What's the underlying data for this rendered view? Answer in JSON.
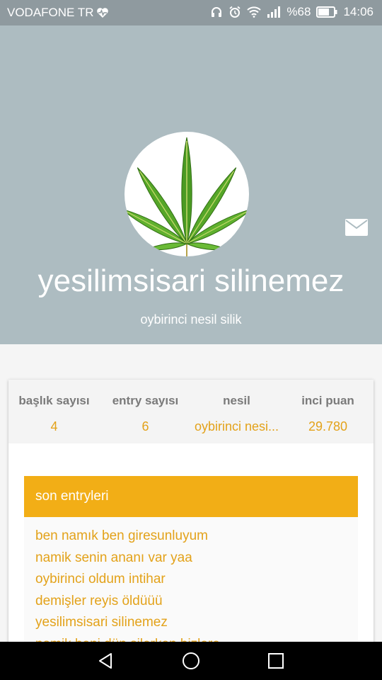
{
  "status_bar": {
    "carrier": "VODAFONE TR",
    "battery": "%68",
    "time": "14:06"
  },
  "profile": {
    "name": "yesilimsisari silinemez",
    "subtitle": "oybirinci nesil silik"
  },
  "stats": [
    {
      "label": "başlık sayısı",
      "value": "4"
    },
    {
      "label": "entry sayısı",
      "value": "6"
    },
    {
      "label": "nesil",
      "value": "oybirinci nesi..."
    },
    {
      "label": "inci puan",
      "value": "29.780"
    }
  ],
  "entries": {
    "title": "son entryleri",
    "items": [
      "ben namık ben giresunluyum",
      "namik senin ananı var yaa",
      "oybirinci oldum intihar",
      "demişler reyis öldüüü",
      "yesilimsisari silinemez",
      "namik beni dün silerken bizlere"
    ]
  },
  "colors": {
    "header_bg": "#adbcc1",
    "accent": "#f2ae16",
    "accent_text": "#e3a21a"
  },
  "icons": [
    "heart-monitor-icon",
    "headphones-icon",
    "alarm-icon",
    "wifi-icon",
    "signal-icon",
    "battery-icon",
    "mail-icon",
    "back-icon",
    "home-icon",
    "recents-icon"
  ]
}
